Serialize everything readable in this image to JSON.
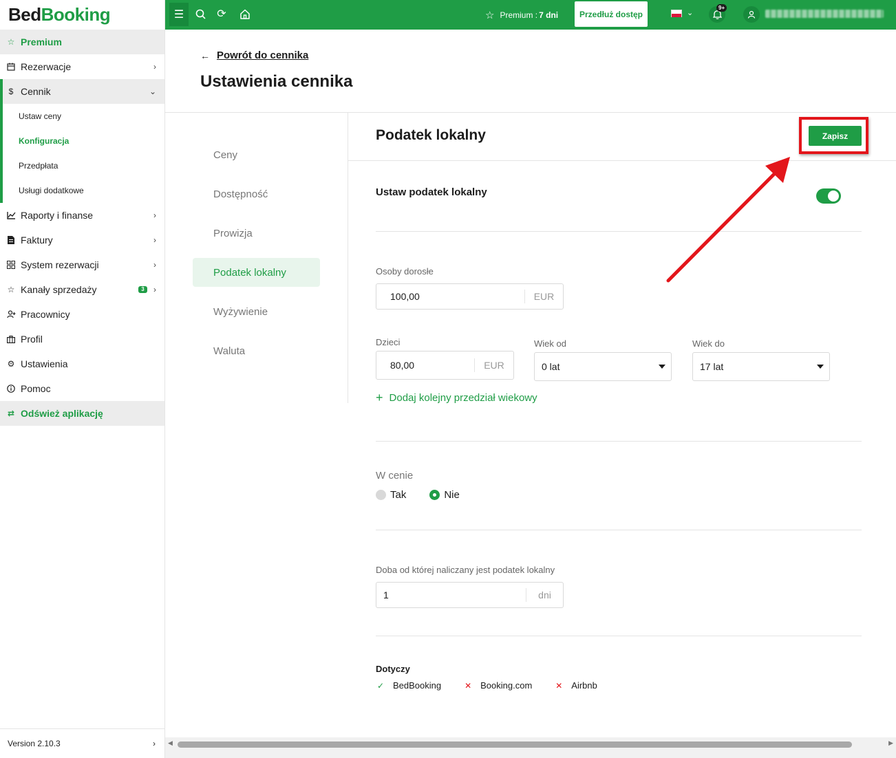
{
  "brand": {
    "part1": "Bed",
    "part2": "Booking"
  },
  "sidebar": {
    "premium": "Premium",
    "items": [
      {
        "label": "Rezerwacje"
      },
      {
        "label": "Cennik"
      }
    ],
    "cennik_sub": [
      {
        "label": "Ustaw ceny"
      },
      {
        "label": "Konfiguracja"
      },
      {
        "label": "Przedpłata"
      },
      {
        "label": "Usługi dodatkowe"
      }
    ],
    "items2": [
      {
        "label": "Raporty i finanse"
      },
      {
        "label": "Faktury"
      },
      {
        "label": "System rezerwacji"
      },
      {
        "label": "Kanały sprzedaży",
        "badge": "3"
      },
      {
        "label": "Pracownicy"
      },
      {
        "label": "Profil"
      },
      {
        "label": "Ustawienia"
      },
      {
        "label": "Pomoc"
      }
    ],
    "refresh": "Odśwież aplikację",
    "version": "Version 2.10.3"
  },
  "topbar": {
    "premium_label": "Premium :",
    "premium_days": "7 dni",
    "extend_button": "Przedłuż dostęp",
    "notifications_badge": "9+"
  },
  "page": {
    "back_link": "Powrót do cennika",
    "title": "Ustawienia cennika"
  },
  "settings_nav": [
    {
      "label": "Ceny"
    },
    {
      "label": "Dostępność"
    },
    {
      "label": "Prowizja"
    },
    {
      "label": "Podatek lokalny"
    },
    {
      "label": "Wyżywienie"
    },
    {
      "label": "Waluta"
    }
  ],
  "panel": {
    "title": "Podatek lokalny",
    "save_button": "Zapisz",
    "set_tax_label": "Ustaw podatek lokalny",
    "set_tax_enabled": true,
    "adults_label": "Osoby dorosłe",
    "adults_value": "100,00",
    "adults_unit": "EUR",
    "children_label": "Dzieci",
    "children_value": "80,00",
    "children_unit": "EUR",
    "age_from_label": "Wiek od",
    "age_from_value": "0 lat",
    "age_to_label": "Wiek do",
    "age_to_value": "17 lat",
    "add_age_range": "Dodaj kolejny przedział wiekowy",
    "in_price_label": "W cenie",
    "in_price_options": [
      "Tak",
      "Nie"
    ],
    "in_price_selected": "Nie",
    "night_label": "Doba od której naliczany jest podatek lokalny",
    "night_value": "1",
    "night_unit": "dni",
    "applies_label": "Dotyczy",
    "applies": [
      {
        "name": "BedBooking",
        "enabled": true
      },
      {
        "name": "Booking.com",
        "enabled": false
      },
      {
        "name": "Airbnb",
        "enabled": false
      }
    ]
  },
  "colors": {
    "brand_green": "#1f9d46",
    "annotation_red": "#e3161b"
  }
}
